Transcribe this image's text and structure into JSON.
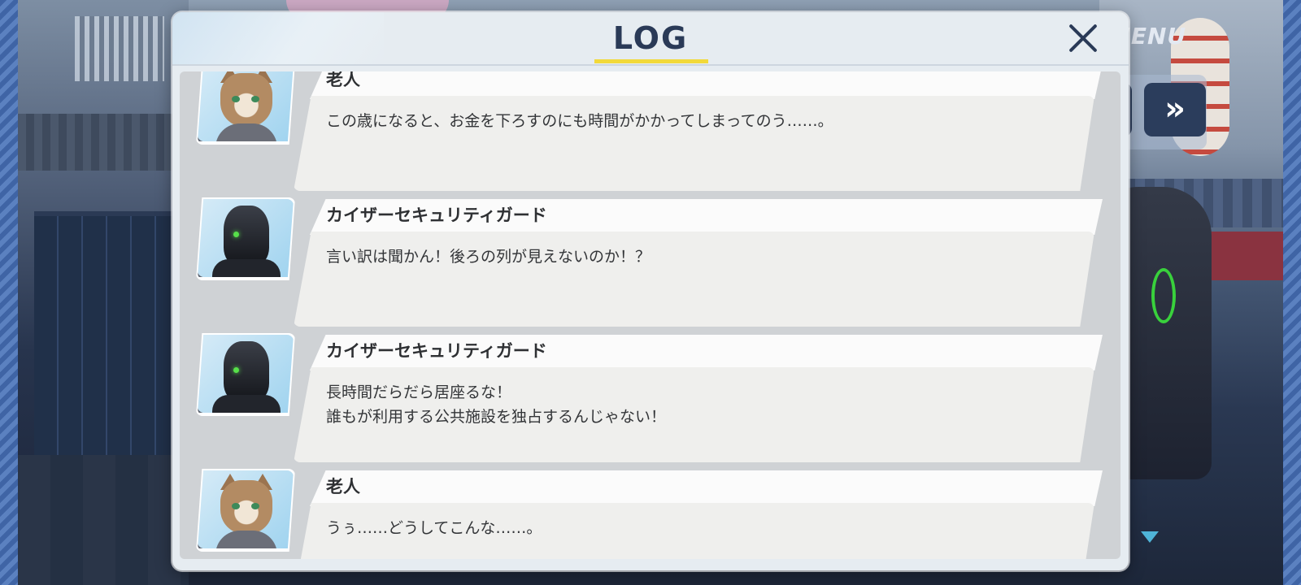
{
  "screen": {
    "menu_label": "MENU",
    "fast_forward_icon": "»",
    "accent_color": "#f2d93a",
    "title_color": "#2a3a57"
  },
  "log": {
    "title": "LOG",
    "entries": [
      {
        "speaker": "老人",
        "avatar": "cat-elder-portrait",
        "lines": [
          "この歳になると、お金を下ろすのにも時間がかかってしまってのう……。"
        ]
      },
      {
        "speaker": "カイザーセキュリティガード",
        "avatar": "robot-guard-portrait",
        "lines": [
          "言い訳は聞かん！後ろの列が見えないのか！？"
        ]
      },
      {
        "speaker": "カイザーセキュリティガード",
        "avatar": "robot-guard-portrait",
        "lines": [
          "長時間だらだら居座るな！",
          "誰もが利用する公共施設を独占するんじゃない！"
        ]
      },
      {
        "speaker": "老人",
        "avatar": "cat-elder-portrait",
        "lines": [
          "うぅ……どうしてこんな……。"
        ]
      }
    ]
  }
}
